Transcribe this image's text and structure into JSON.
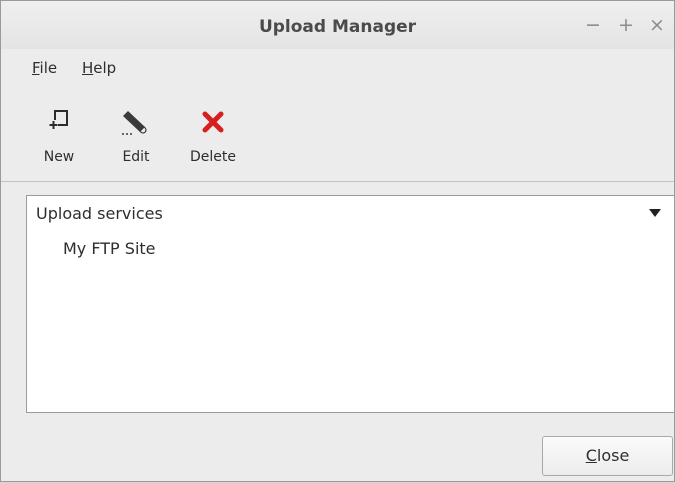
{
  "window": {
    "title": "Upload Manager",
    "controls": {
      "minimize": "−",
      "maximize": "+",
      "close": "×"
    }
  },
  "menubar": {
    "file": {
      "mnemonic": "F",
      "rest": "ile"
    },
    "help": {
      "mnemonic": "H",
      "rest": "elp"
    }
  },
  "toolbar": {
    "new_label": "New",
    "edit_label": "Edit",
    "delete_label": "Delete",
    "icons": {
      "new": "new-document-icon",
      "edit": "pencil-icon",
      "delete": "red-x-icon"
    },
    "colors": {
      "delete_icon": "#d81e1e"
    }
  },
  "services_combo": {
    "selected": "Upload services"
  },
  "services_list": {
    "items": [
      "My FTP Site"
    ]
  },
  "footer": {
    "close": {
      "mnemonic": "C",
      "rest": "lose"
    }
  }
}
